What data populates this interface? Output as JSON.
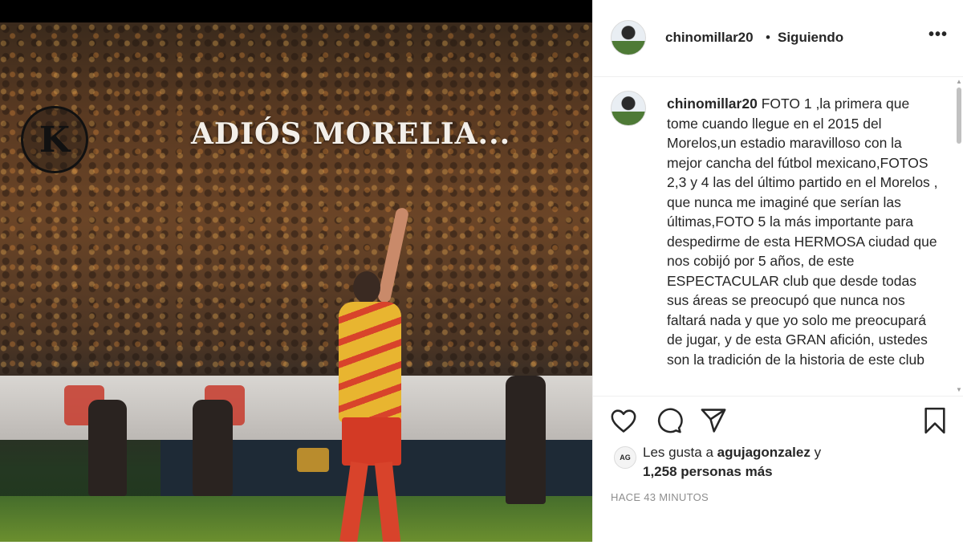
{
  "photo": {
    "overlay_title": "ADIÓS MORELIA...",
    "watermark_letter": "K"
  },
  "header": {
    "username": "chinomillar20",
    "separator": "•",
    "follow_label": "Siguiendo",
    "more_label": "•••"
  },
  "caption": {
    "username": "chinomillar20",
    "text": "FOTO 1 ,la primera que tome cuando llegue en el 2015 del Morelos,un estadio maravilloso con la mejor cancha del fútbol mexicano,FOTOS 2,3 y 4 las del último partido en el Morelos , que nunca me imaginé que serían las últimas,FOTO 5 la más importante para despedirme de esta HERMOSA ciudad que nos cobijó por 5 años, de este ESPECTACULAR club que desde todas sus áreas se preocupó que nunca nos faltará nada y que yo solo me preocupará de jugar, y de esta GRAN afición, ustedes son la tradición de la historia de este club"
  },
  "actions": {
    "like_icon": "heart-outline-icon",
    "comment_icon": "comment-bubble-icon",
    "share_icon": "paper-plane-icon",
    "save_icon": "bookmark-icon"
  },
  "likes": {
    "avatar_initials": "AG",
    "prefix": "Les gusta a",
    "liker": "agujagonzalez",
    "conjunction": "y",
    "others": "1,258 personas más"
  },
  "timestamp": "HACE 43 MINUTOS"
}
